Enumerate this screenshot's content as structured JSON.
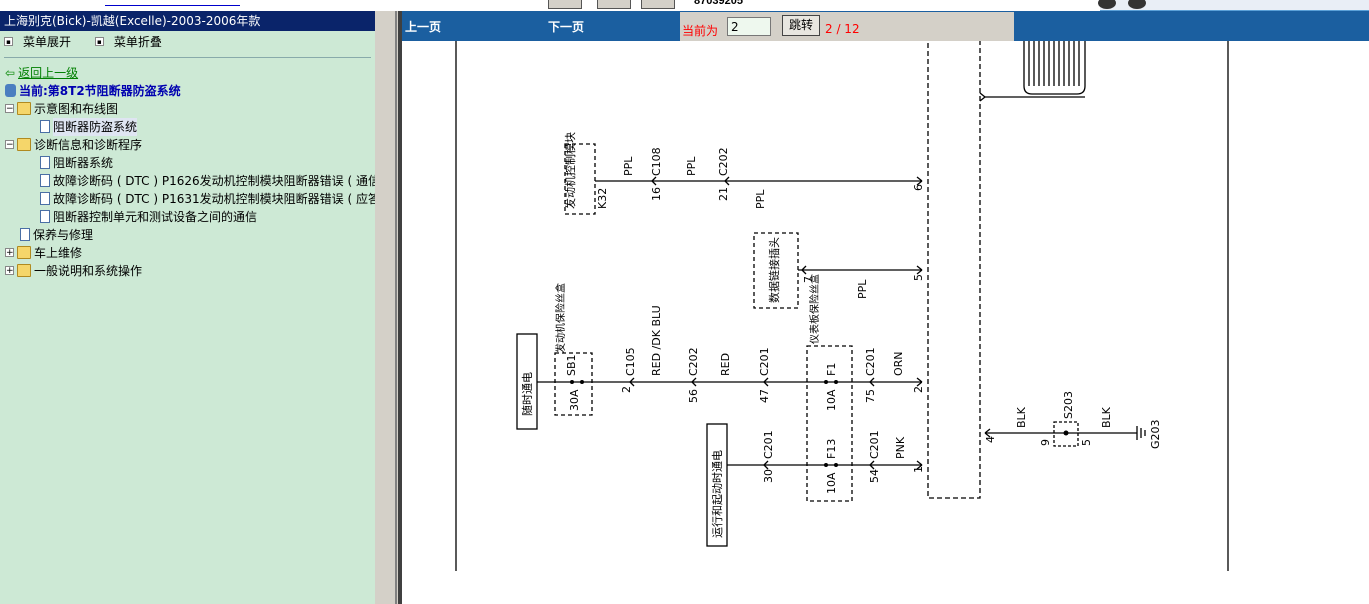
{
  "top": {
    "code": "87039205"
  },
  "left_panel": {
    "title": "上海别克(Bick)-凯越(Excelle)-2003-2006年款",
    "expand_label": "菜单展开",
    "collapse_label": "菜单折叠",
    "back_label": "返回上一级",
    "current_label": "当前:第8T2节阻断器防盗系统",
    "tree": [
      {
        "label": "示意图和布线图"
      },
      {
        "label": "阻断器防盗系统"
      },
      {
        "label": "诊断信息和诊断程序"
      },
      {
        "label": "阻断器系统"
      },
      {
        "label": "故障诊断码 ( DTC ) P1626发动机控制模块阻断器错误 ( 通信"
      },
      {
        "label": "故障诊断码 ( DTC ) P1631发动机控制模块阻断器错误 ( 应答"
      },
      {
        "label": "阻断器控制单元和测试设备之间的通信"
      },
      {
        "label": "保养与修理"
      },
      {
        "label": "车上维修"
      },
      {
        "label": "一般说明和系统操作"
      }
    ]
  },
  "navbar": {
    "prev_label": "上一页",
    "next_label": "下一页",
    "current_label": "当前为",
    "page_value": "2",
    "goto_label": "跳转",
    "page_count": "2 / 12"
  },
  "diagram": {
    "ecm_label": "发动机控制模块",
    "k32": "K32",
    "ppl": "PPL",
    "c108": "C108",
    "c202": "C202",
    "c105": "C105",
    "c201": "C201",
    "pin16": "16",
    "pin21": "21",
    "pin6": "6",
    "dlc_label": "数据链接插头",
    "pin7": "7",
    "pin5": "5",
    "hot_label": "随时通电",
    "engine_fuse_box": "发动机保险丝盒",
    "sb1": "SB1",
    "amp30": "30A",
    "pin2a": "2",
    "red_dkblu": "RED /DK BLU",
    "pin56": "56",
    "red": "RED",
    "pin47": "47",
    "ip_fuse_box": "仪表板保险丝盒",
    "f1": "F1",
    "amp10": "10A",
    "pin75": "75",
    "orn": "ORN",
    "pin2b": "2",
    "run_crank_label": "运行和起动时通电",
    "pin30": "30",
    "f13": "F13",
    "pin54": "54",
    "pnk": "PNK",
    "pin1": "1",
    "pin4": "4",
    "blk": "BLK",
    "s203": "S203",
    "pin9": "9",
    "g203": "G203"
  },
  "colors": {
    "navbar": "#1b5fa0",
    "left_bg": "#cde9d5",
    "titlebar": "#0a246a",
    "red_text": "#ff0000"
  }
}
